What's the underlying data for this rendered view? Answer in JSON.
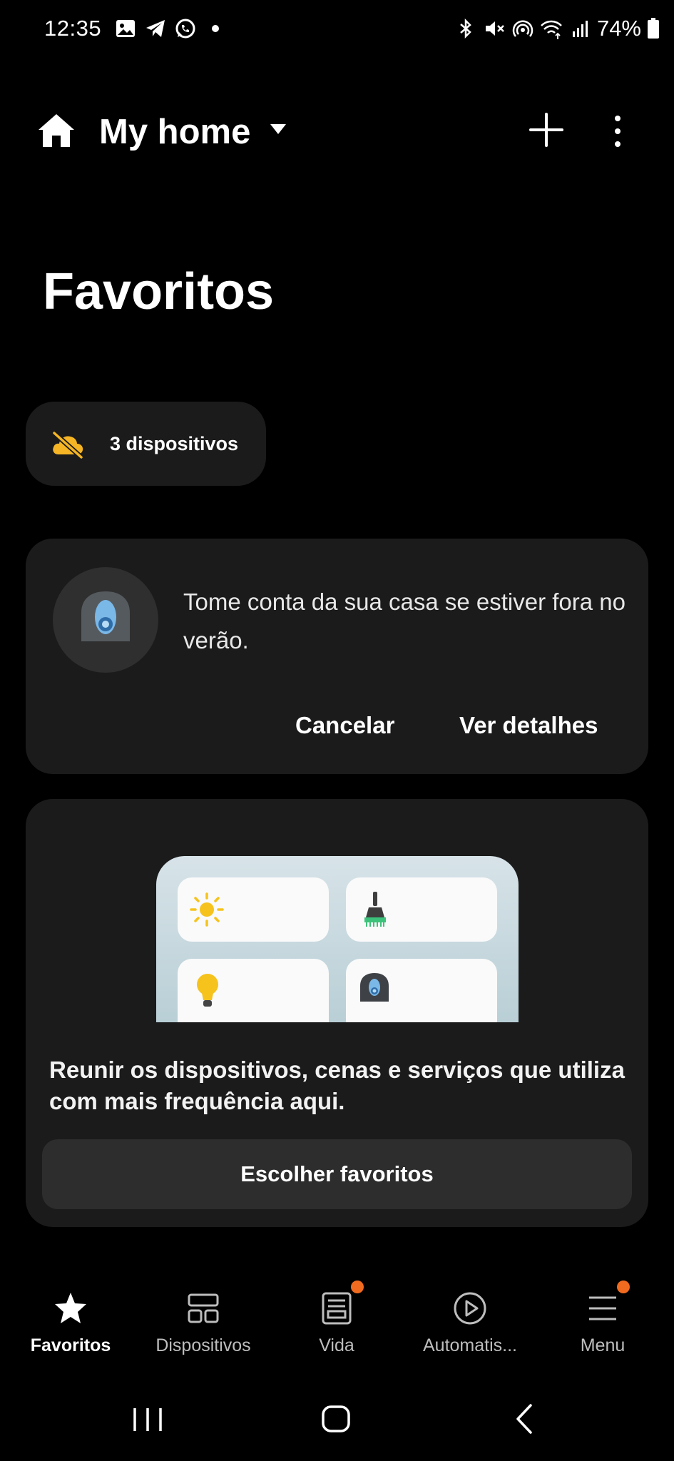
{
  "status_bar": {
    "time": "12:35",
    "battery": "74%",
    "left_icons": [
      "gallery-icon",
      "telegram-icon",
      "whatsapp-icon",
      "dot-icon"
    ],
    "right_icons": [
      "bluetooth-icon",
      "mute-icon",
      "hotspot-icon",
      "wifi-icon",
      "signal-icon",
      "battery-icon"
    ]
  },
  "header": {
    "title": "My home",
    "icons": [
      "home-icon",
      "dropdown-icon",
      "plus-icon",
      "more-vertical-icon"
    ]
  },
  "page_title": "Favoritos",
  "offline_chip": {
    "label": "3 dispositivos",
    "icon": "cloud-off-icon",
    "icon_color": "#f5b524"
  },
  "tip_card": {
    "text": "Tome conta da sua casa se estiver fora no verão.",
    "cancel_label": "Cancelar",
    "details_label": "Ver detalhes",
    "icon": "robot-vacuum-icon"
  },
  "favorites_card": {
    "description": "Reunir os dispositivos, cenas e serviços que utiliza com mais frequência aqui.",
    "button_label": "Escolher favoritos",
    "illustration_icons": [
      "sun-icon",
      "cleaner-icon",
      "bulb-icon",
      "robot-vacuum-icon"
    ]
  },
  "bottom_nav": {
    "items": [
      {
        "label": "Favoritos",
        "icon": "star-icon",
        "active": true,
        "badge": false
      },
      {
        "label": "Dispositivos",
        "icon": "devices-icon",
        "active": false,
        "badge": false
      },
      {
        "label": "Vida",
        "icon": "life-icon",
        "active": false,
        "badge": true
      },
      {
        "label": "Automatis...",
        "icon": "play-circle-icon",
        "active": false,
        "badge": false
      },
      {
        "label": "Menu",
        "icon": "menu-icon",
        "active": false,
        "badge": true
      }
    ],
    "badge_color": "#f06b1f"
  },
  "system_nav": {
    "buttons": [
      "recents-button",
      "home-button",
      "back-button"
    ]
  }
}
